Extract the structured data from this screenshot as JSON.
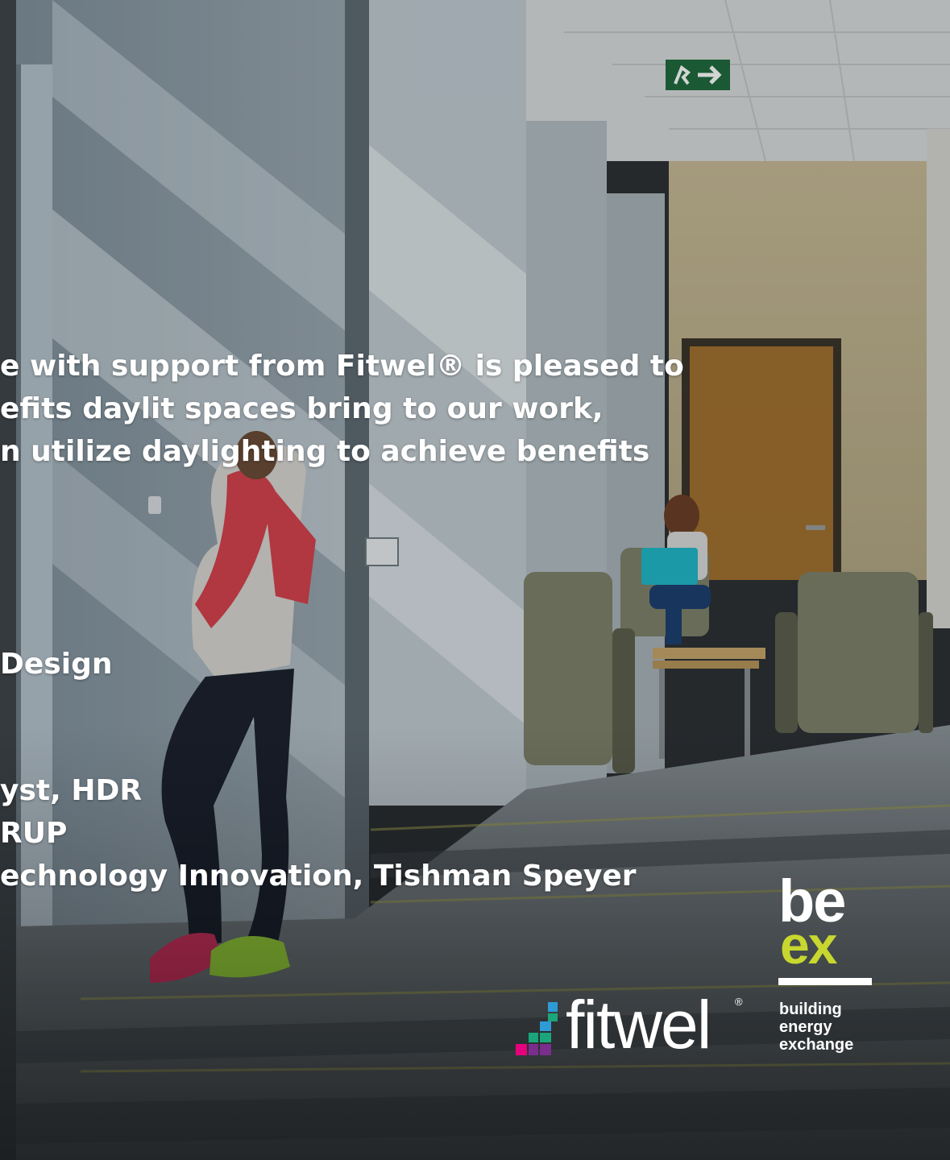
{
  "slide": {
    "intro_lines": [
      "e with support from Fitwel® is pleased to",
      "efits daylit spaces bring to our work,",
      "n utilize daylighting to achieve benefits"
    ],
    "role": "Design",
    "speakers": [
      "yst, HDR",
      "RUP",
      "echnology Innovation, Tishman Speyer"
    ]
  },
  "logos": {
    "fitwel": {
      "wordmark": "fitwel",
      "registered": "®",
      "colors": [
        "#e6007e",
        "#7b2d8e",
        "#2e9bd6",
        "#1aa67a"
      ]
    },
    "beex": {
      "be": "be",
      "ex": "ex",
      "subtitle": [
        "building",
        "energy",
        "exchange"
      ],
      "accent": "#c8d72f"
    }
  },
  "signage": {
    "exit_sign": "exit-sign-icon"
  }
}
